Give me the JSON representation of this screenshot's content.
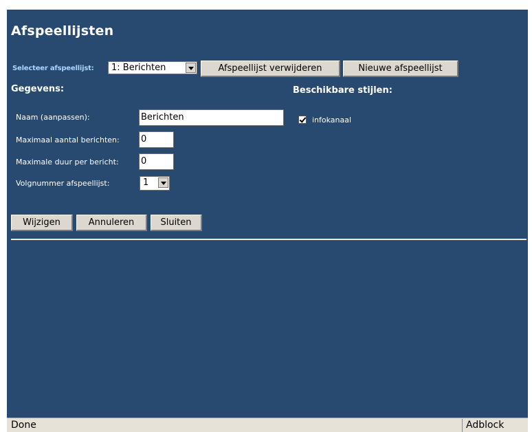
{
  "page": {
    "title": "Afspeellijsten"
  },
  "playlist_select": {
    "label": "Selecteer afspeellijst:",
    "selected": "1: Berichten"
  },
  "toolbar": {
    "delete_label": "Afspeellijst verwijderen",
    "new_label": "Nieuwe afspeellijst"
  },
  "details": {
    "heading": "Gegevens:",
    "name_label": "Naam (aanpassen):",
    "name_value": "Berichten",
    "max_messages_label": "Maximaal aantal berichten:",
    "max_messages_value": "0",
    "max_duration_label": "Maximale duur per bericht:",
    "max_duration_value": "0",
    "order_label": "Volgnummer afspeellijst:",
    "order_value": "1"
  },
  "styles": {
    "heading": "Beschikbare stijlen:",
    "items": [
      {
        "label": "infokanaal",
        "checked": true
      }
    ]
  },
  "actions": {
    "change_label": "Wijzigen",
    "cancel_label": "Annuleren",
    "close_label": "Sluiten"
  },
  "statusbar": {
    "status": "Done",
    "adblock": "Adblock"
  },
  "colors": {
    "panel_bg": "#284a70",
    "accent_label": "#a9d6ff",
    "button_face": "#dcd8cf"
  }
}
